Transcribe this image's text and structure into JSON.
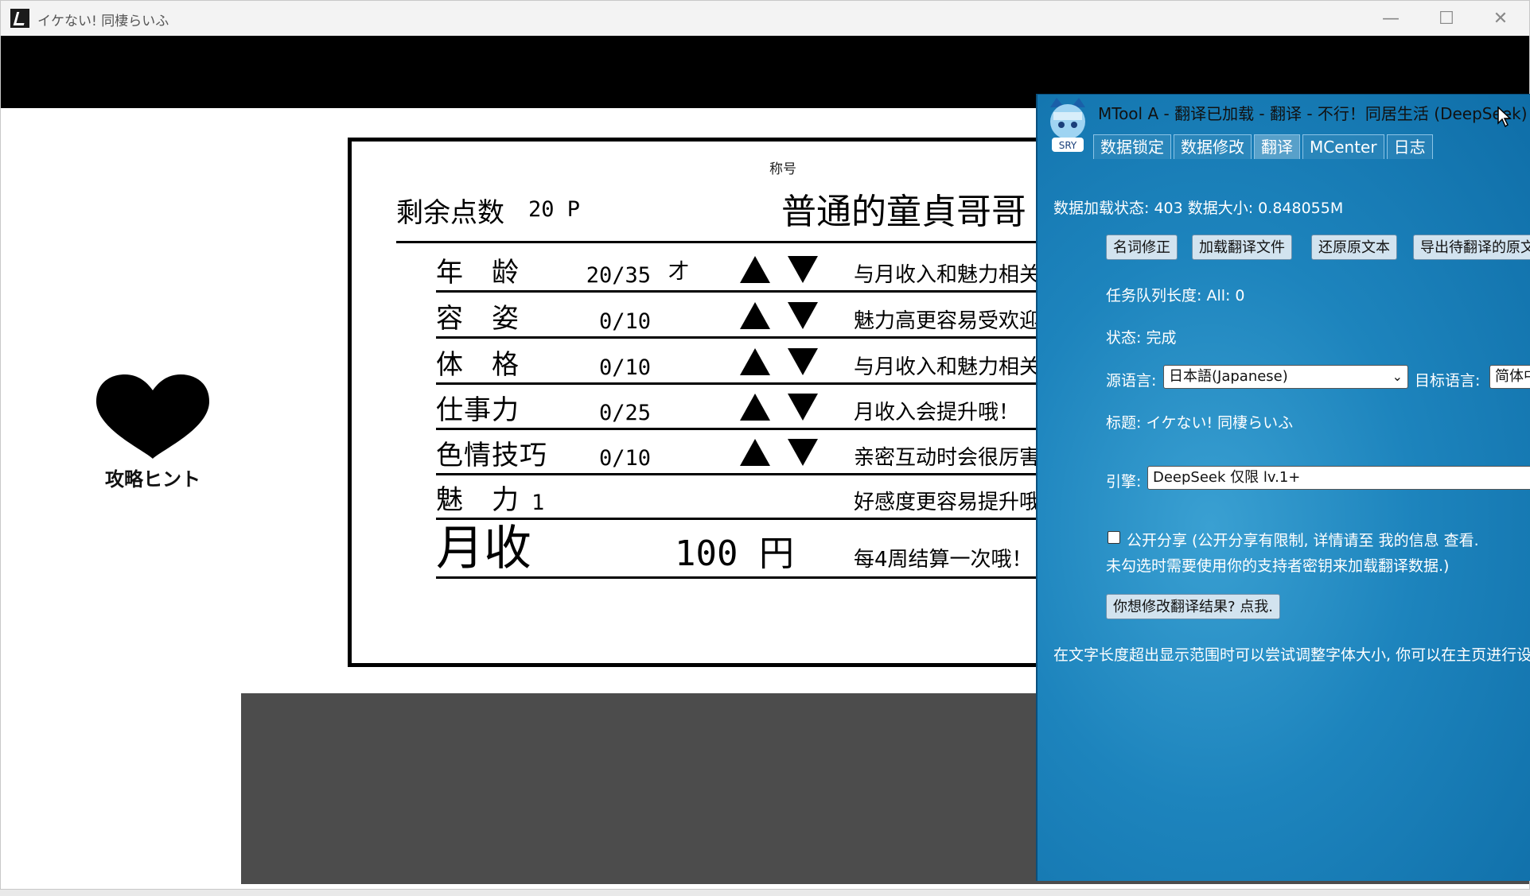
{
  "window": {
    "title": "イケない! 同棲らいふ",
    "min_glyph": "—",
    "max_glyph": "☐",
    "close_glyph": "✕"
  },
  "hint": {
    "label": "攻略ヒント",
    "icon": "heart-icon"
  },
  "panel": {
    "title_caption": "称号",
    "title_value": "普通的童貞哥哥",
    "points_label": "剩余点数",
    "points_value": "20 P",
    "stats": [
      {
        "label": "年　龄",
        "value": "20/35",
        "unit": "才",
        "desc": "与月收入和魅力相关哦",
        "adjustable": true
      },
      {
        "label": "容　姿",
        "value": "0/10",
        "unit": "",
        "desc": "魅力高更容易受欢迎哦",
        "adjustable": true
      },
      {
        "label": "体　格",
        "value": "0/10",
        "unit": "",
        "desc": "与月收入和魅力相关哦",
        "adjustable": true
      },
      {
        "label": "仕事力",
        "value": "0/25",
        "unit": "",
        "desc": "月收入会提升哦！",
        "adjustable": true
      },
      {
        "label": "色情技巧",
        "value": "0/10",
        "unit": "",
        "desc": "亲密互动时会很厉害哦",
        "adjustable": true
      },
      {
        "label": "魅　力",
        "value": "1",
        "unit": "",
        "desc": "好感度更容易提升哦",
        "adjustable": false
      }
    ],
    "income": {
      "label": "月收",
      "value": "100 円",
      "desc": "每4周结算一次哦！"
    }
  },
  "mtool": {
    "title": "MTool A - 翻译已加载 - 翻译 - 不行！同居生活 (DeepSeek)",
    "tabs": [
      "数据锁定",
      "数据修改",
      "翻译",
      "MCenter",
      "日志"
    ],
    "active_tab": "翻译",
    "load_status": "数据加载状态: 403 数据大小: 0.848055M",
    "buttons": [
      "名词修正",
      "加载翻译文件",
      "还原原文本",
      "导出待翻译的原文"
    ],
    "queue": "任务队列长度: All: 0",
    "status": "状态: 完成",
    "source_lang_label": "源语言:",
    "source_lang_value": "日本語(Japanese)",
    "target_lang_label": "目标语言:",
    "target_lang_value": "简体中文",
    "title_line": "标题: イケない! 同棲らいふ",
    "engine_label": "引擎:",
    "engine_value": "DeepSeek 仅限 lv.1+",
    "share_line1": "公开分享 (公开分享有限制, 详情请至 我的信息 查看.",
    "share_line2": "未勾选时需要使用你的支持者密钥来加载翻译数据.)",
    "modify_button": "你想修改翻译结果? 点我.",
    "font_tip": "在文字长度超出显示范围时可以尝试调整字体大小, 你可以在主页进行设置",
    "avatar_badge": "SRY"
  }
}
